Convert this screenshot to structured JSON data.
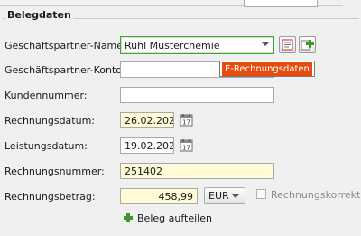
{
  "section_title": "Belegdaten",
  "fields": {
    "partner_name": {
      "label": "Geschäftspartner-Name:",
      "value": "Rühl Musterchemie"
    },
    "partner_account": {
      "label": "Geschäftspartner-Konto:",
      "value": ""
    },
    "customer_number": {
      "label": "Kundennummer:",
      "value": ""
    },
    "invoice_date": {
      "label": "Rechnungsdatum:",
      "value": "26.02.2024"
    },
    "service_date": {
      "label": "Leistungsdatum:",
      "value": "19.02.2024"
    },
    "invoice_number": {
      "label": "Rechnungsnummer:",
      "value": "251402"
    },
    "invoice_amount": {
      "label": "Rechnungsbetrag:",
      "value": "458,99"
    }
  },
  "currency": {
    "value": "EUR"
  },
  "correction_checkbox": {
    "label": "Rechnungskorrektur",
    "checked": false
  },
  "tooltip": {
    "text": "E-Rechnungsdaten"
  },
  "split_button": {
    "label": "Beleg aufteilen"
  },
  "icons": {
    "partner_details": "address-card-icon",
    "partner_add": "add-partner-icon",
    "calendar": "calendar-icon",
    "split": "plus-icon"
  },
  "colors": {
    "tooltip_badge": "#e74c0f",
    "combo_focus_border": "#4aa136",
    "highlighted_field": "#fffbd7",
    "add_icon": "#3b9a2a"
  }
}
